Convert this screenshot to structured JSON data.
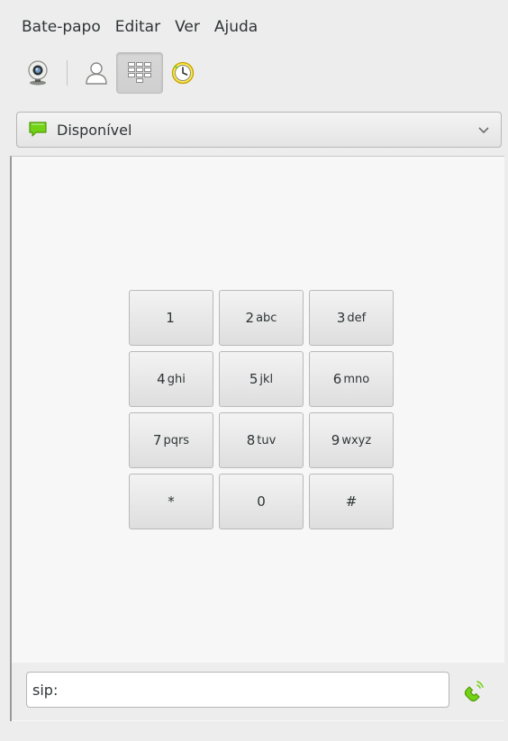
{
  "menubar": {
    "items": [
      "Bate-papo",
      "Editar",
      "Ver",
      "Ajuda"
    ]
  },
  "toolbar": {
    "buttons": [
      {
        "icon": "webcam-icon",
        "active": false
      },
      {
        "icon": "contacts-icon",
        "active": false
      },
      {
        "icon": "dialpad-icon",
        "active": true
      },
      {
        "icon": "history-icon",
        "active": false
      }
    ]
  },
  "presence": {
    "status": "Disponível",
    "icon": "available-status-icon",
    "status_color": "#73d216"
  },
  "dialpad": {
    "keys": [
      {
        "digit": "1",
        "letters": ""
      },
      {
        "digit": "2",
        "letters": "abc"
      },
      {
        "digit": "3",
        "letters": "def"
      },
      {
        "digit": "4",
        "letters": "ghi"
      },
      {
        "digit": "5",
        "letters": "jkl"
      },
      {
        "digit": "6",
        "letters": "mno"
      },
      {
        "digit": "7",
        "letters": "pqrs"
      },
      {
        "digit": "8",
        "letters": "tuv"
      },
      {
        "digit": "9",
        "letters": "wxyz"
      },
      {
        "digit": "*",
        "letters": ""
      },
      {
        "digit": "0",
        "letters": ""
      },
      {
        "digit": "#",
        "letters": ""
      }
    ]
  },
  "sip": {
    "value": "sip:",
    "call_icon": "phone-call-icon",
    "call_color": "#73d216"
  }
}
